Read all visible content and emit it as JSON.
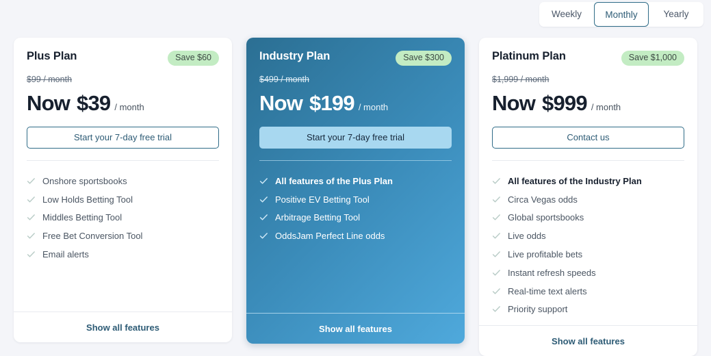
{
  "billing_toggle": {
    "options": [
      {
        "label": "Weekly",
        "selected": false
      },
      {
        "label": "Monthly",
        "selected": true
      },
      {
        "label": "Yearly",
        "selected": false
      }
    ]
  },
  "colors": {
    "page_bg": "#f4f5f9",
    "badge_green": "#c3ecc3",
    "accent_blue": "#2d5b75",
    "featured_gradient_start": "#2b6f93",
    "featured_gradient_end": "#4fa9dc",
    "featured_cta": "#a8d8f0",
    "check_muted": "#b9ccc7"
  },
  "show_all_features_label": "Show all features",
  "plans": [
    {
      "name": "Plus Plan",
      "badge": "Save $60",
      "old_price": "$99 / month",
      "now_label": "Now",
      "price": "$39",
      "period": "/ month",
      "cta_label": "Start your 7-day free trial",
      "cta_style": "outline",
      "featured": false,
      "features": [
        {
          "text": "Onshore sportsbooks",
          "bold": false
        },
        {
          "text": "Low Holds Betting Tool",
          "bold": false
        },
        {
          "text": "Middles Betting Tool",
          "bold": false
        },
        {
          "text": "Free Bet Conversion Tool",
          "bold": false
        },
        {
          "text": "Email alerts",
          "bold": false
        }
      ]
    },
    {
      "name": "Industry Plan",
      "badge": "Save $300",
      "old_price": "$499 / month",
      "now_label": "Now",
      "price": "$199",
      "period": "/ month",
      "cta_label": "Start your 7-day free trial",
      "cta_style": "solid",
      "featured": true,
      "features": [
        {
          "text": "All features of the Plus Plan",
          "bold": true
        },
        {
          "text": "Positive EV Betting Tool",
          "bold": false
        },
        {
          "text": "Arbitrage Betting Tool",
          "bold": false
        },
        {
          "text": "OddsJam Perfect Line odds",
          "bold": false
        }
      ]
    },
    {
      "name": "Platinum Plan",
      "badge": "Save $1,000",
      "old_price": "$1,999 / month",
      "now_label": "Now",
      "price": "$999",
      "period": "/ month",
      "cta_label": "Contact us",
      "cta_style": "outline",
      "featured": false,
      "features": [
        {
          "text": "All features of the Industry Plan",
          "bold": true
        },
        {
          "text": "Circa Vegas odds",
          "bold": false
        },
        {
          "text": "Global sportsbooks",
          "bold": false
        },
        {
          "text": "Live odds",
          "bold": false
        },
        {
          "text": "Live profitable bets",
          "bold": false
        },
        {
          "text": "Instant refresh speeds",
          "bold": false
        },
        {
          "text": "Real-time text alerts",
          "bold": false
        },
        {
          "text": "Priority support",
          "bold": false
        }
      ]
    }
  ]
}
